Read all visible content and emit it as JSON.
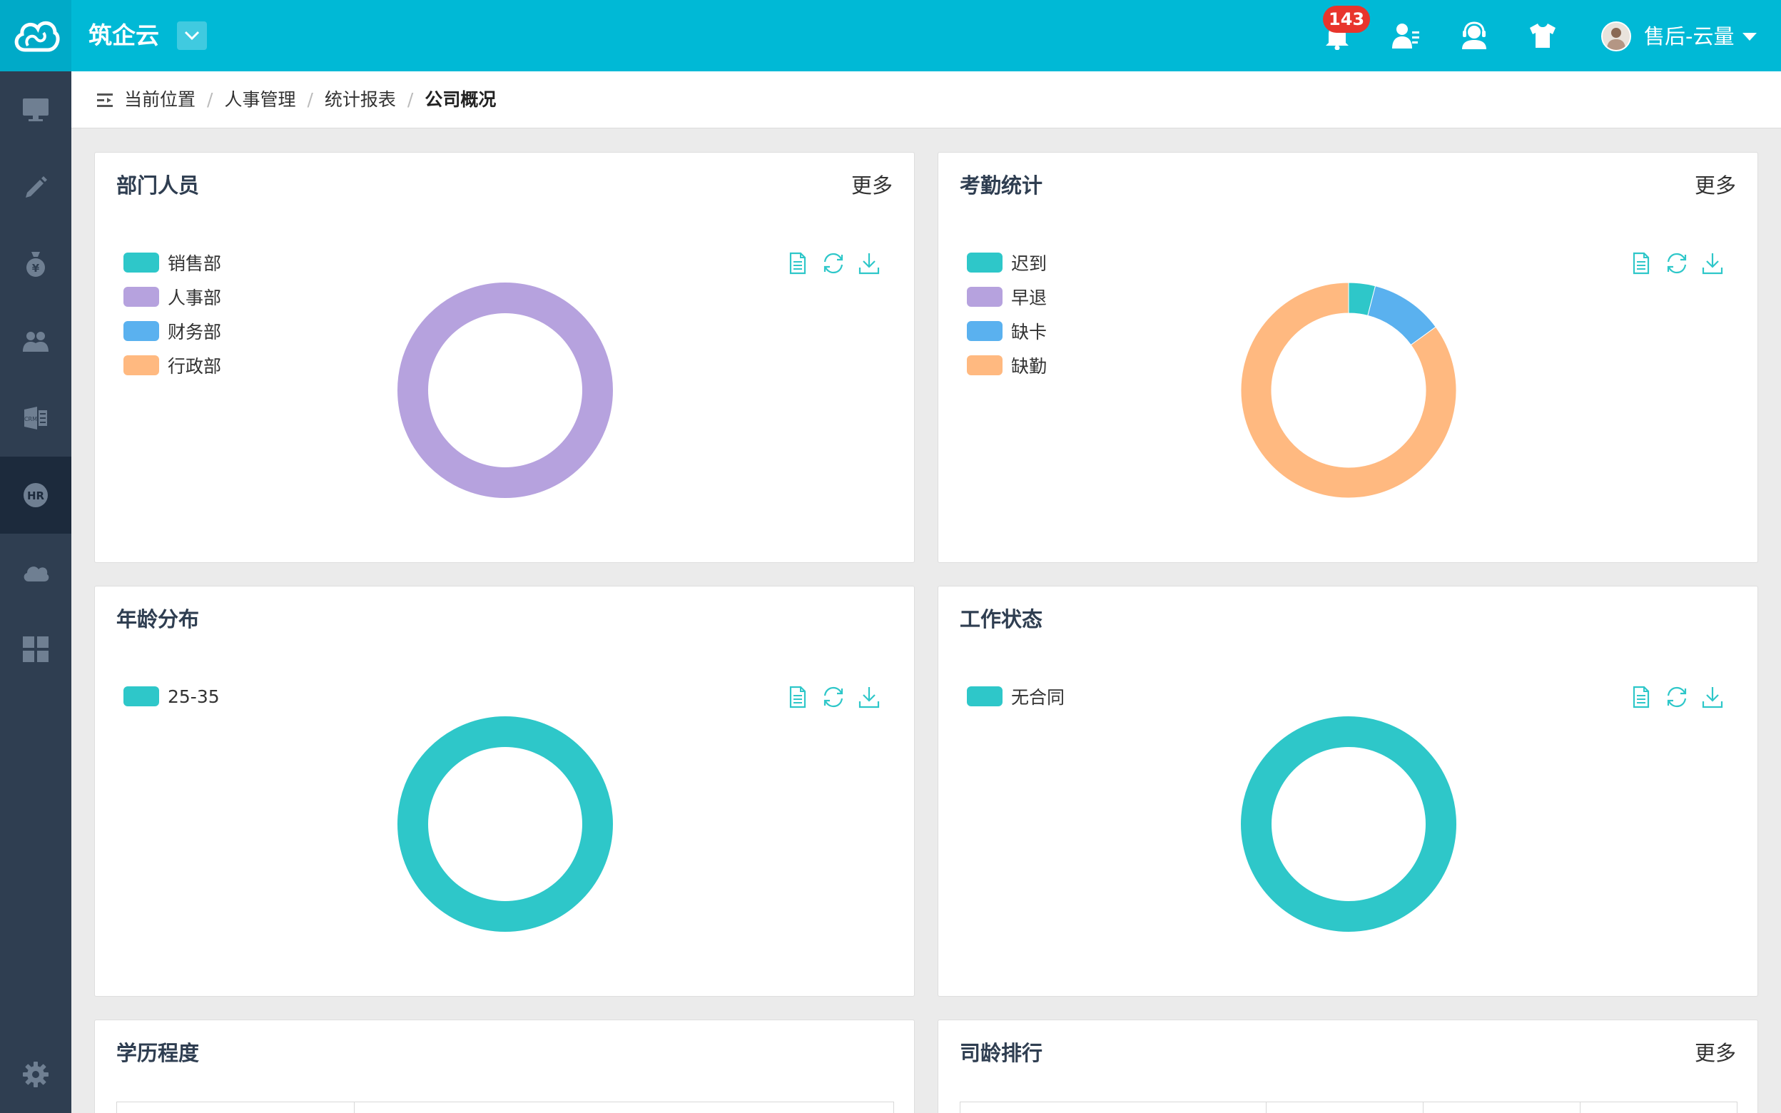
{
  "header": {
    "brand": "筑企云",
    "notification_count": "143",
    "user_name": "售后-云量"
  },
  "sidebar": {
    "items": [
      {
        "icon": "monitor-icon"
      },
      {
        "icon": "pencil-icon"
      },
      {
        "icon": "money-bag-icon"
      },
      {
        "icon": "users-icon"
      },
      {
        "icon": "crm-icon"
      },
      {
        "icon": "hr-icon",
        "active": true
      },
      {
        "icon": "cloud-icon"
      },
      {
        "icon": "grid-icon"
      },
      {
        "icon": "gear-icon"
      }
    ]
  },
  "breadcrumb": {
    "label": "当前位置",
    "items": [
      "人事管理",
      "统计报表",
      "公司概况"
    ]
  },
  "cards": {
    "dept": {
      "title": "部门人员",
      "more": "更多",
      "legend": [
        "销售部",
        "人事部",
        "财务部",
        "行政部"
      ]
    },
    "attendance": {
      "title": "考勤统计",
      "more": "更多",
      "legend": [
        "迟到",
        "早退",
        "缺卡",
        "缺勤"
      ]
    },
    "age": {
      "title": "年龄分布",
      "legend": [
        "25-35"
      ]
    },
    "status": {
      "title": "工作状态",
      "legend": [
        "无合同"
      ]
    },
    "education": {
      "title": "学历程度"
    },
    "seniority": {
      "title": "司龄排行",
      "more": "更多"
    }
  },
  "colors": {
    "teal": "#2ec7c9",
    "purple": "#b6a2de",
    "blue": "#5ab1ef",
    "orange": "#ffb980",
    "topbar": "#00b9d6",
    "sidebar": "#2f3e51"
  },
  "chart_data": [
    {
      "type": "pie",
      "title": "部门人员",
      "categories": [
        "销售部",
        "人事部",
        "财务部",
        "行政部"
      ],
      "values": [
        0,
        1,
        0,
        0
      ],
      "colors": [
        "#2ec7c9",
        "#b6a2de",
        "#5ab1ef",
        "#ffb980"
      ]
    },
    {
      "type": "pie",
      "title": "考勤统计",
      "categories": [
        "迟到",
        "早退",
        "缺卡",
        "缺勤"
      ],
      "values": [
        0.04,
        0,
        0.11,
        0.85
      ],
      "colors": [
        "#2ec7c9",
        "#b6a2de",
        "#5ab1ef",
        "#ffb980"
      ]
    },
    {
      "type": "pie",
      "title": "年龄分布",
      "categories": [
        "25-35"
      ],
      "values": [
        1
      ],
      "colors": [
        "#2ec7c9"
      ]
    },
    {
      "type": "pie",
      "title": "工作状态",
      "categories": [
        "无合同"
      ],
      "values": [
        1
      ],
      "colors": [
        "#2ec7c9"
      ]
    }
  ]
}
